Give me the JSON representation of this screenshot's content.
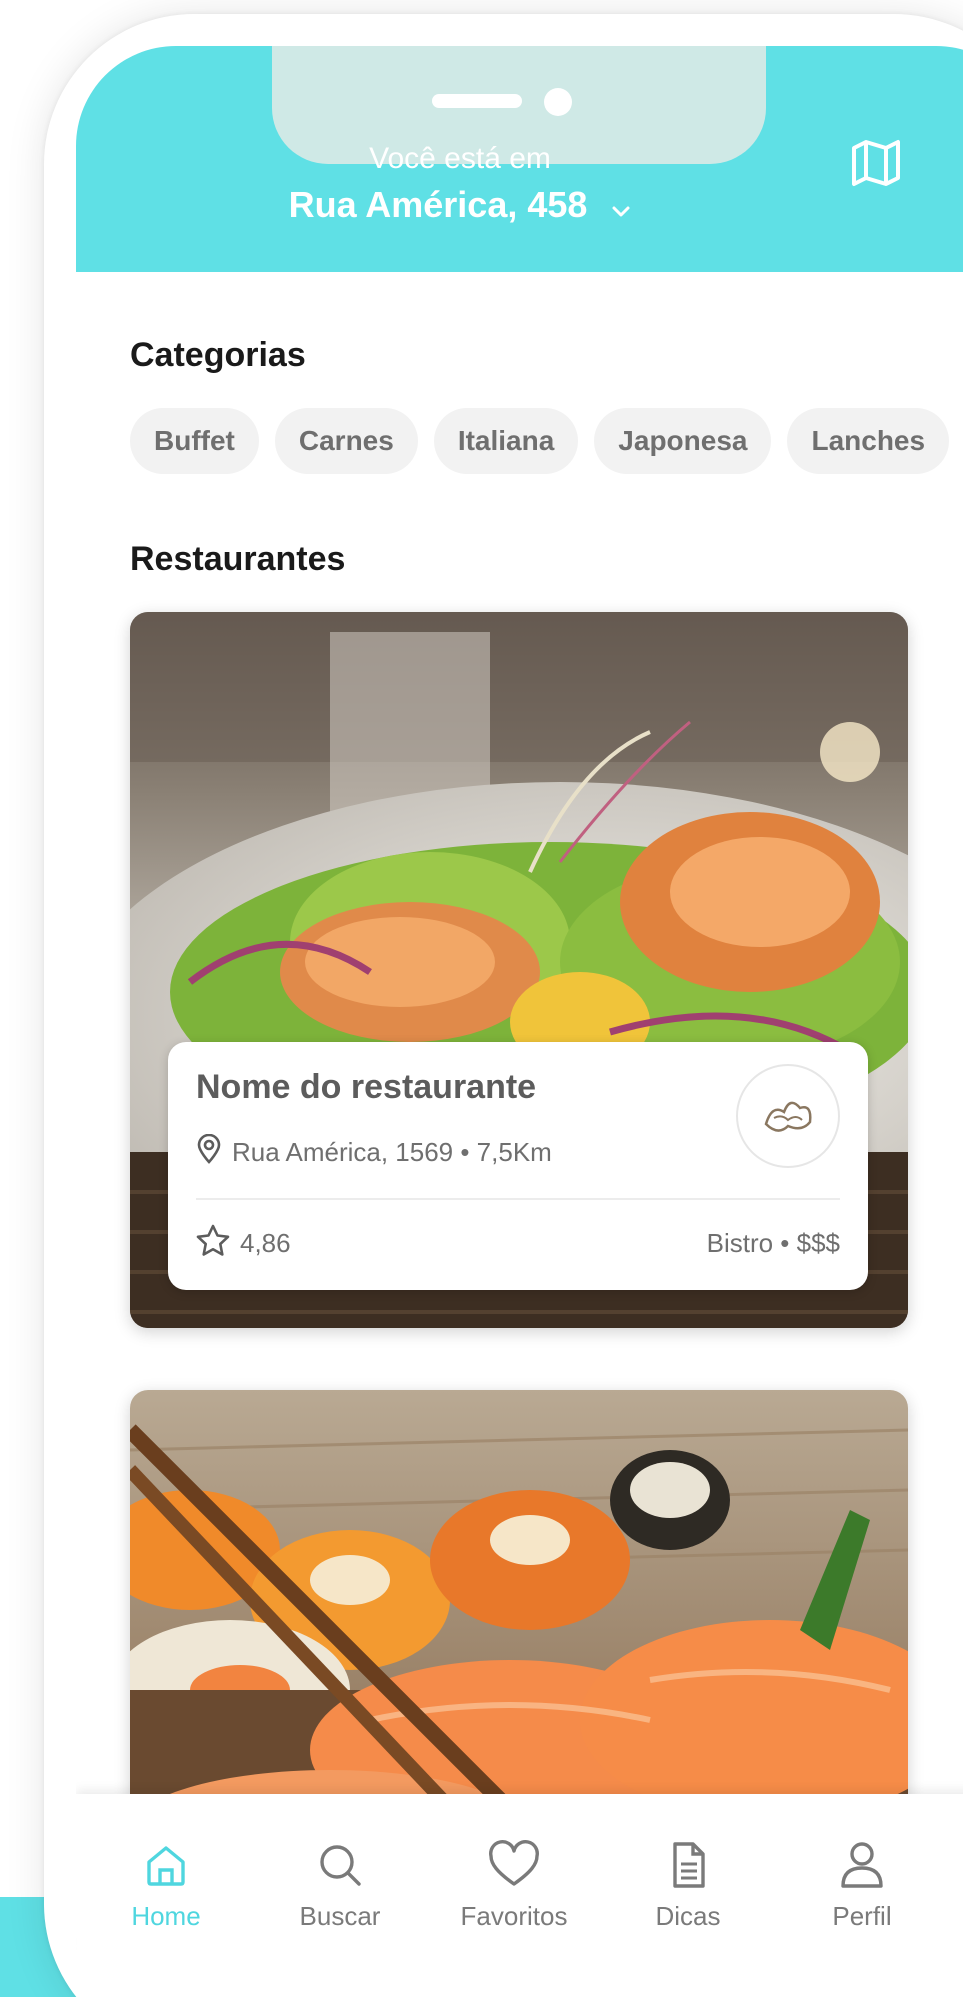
{
  "header": {
    "caption": "Você está em",
    "address": "Rua América, 458"
  },
  "categories": {
    "title": "Categorias",
    "items": [
      "Buffet",
      "Carnes",
      "Italiana",
      "Japonesa",
      "Lanches"
    ]
  },
  "restaurants": {
    "title": "Restaurantes",
    "items": [
      {
        "name": "Nome do restaurante",
        "address": "Rua América, 1569 • 7,5Km",
        "rating": "4,86",
        "type": "Bistro • $$$"
      }
    ]
  },
  "nav": {
    "items": [
      {
        "label": "Home",
        "icon": "home-icon",
        "active": true
      },
      {
        "label": "Buscar",
        "icon": "search-icon",
        "active": false
      },
      {
        "label": "Favoritos",
        "icon": "heart-icon",
        "active": false
      },
      {
        "label": "Dicas",
        "icon": "document-icon",
        "active": false
      },
      {
        "label": "Perfil",
        "icon": "user-icon",
        "active": false
      }
    ]
  },
  "colors": {
    "accent": "#5fe0e5",
    "nav_active": "#4fd6df",
    "chip_bg": "#f2f2f2"
  }
}
